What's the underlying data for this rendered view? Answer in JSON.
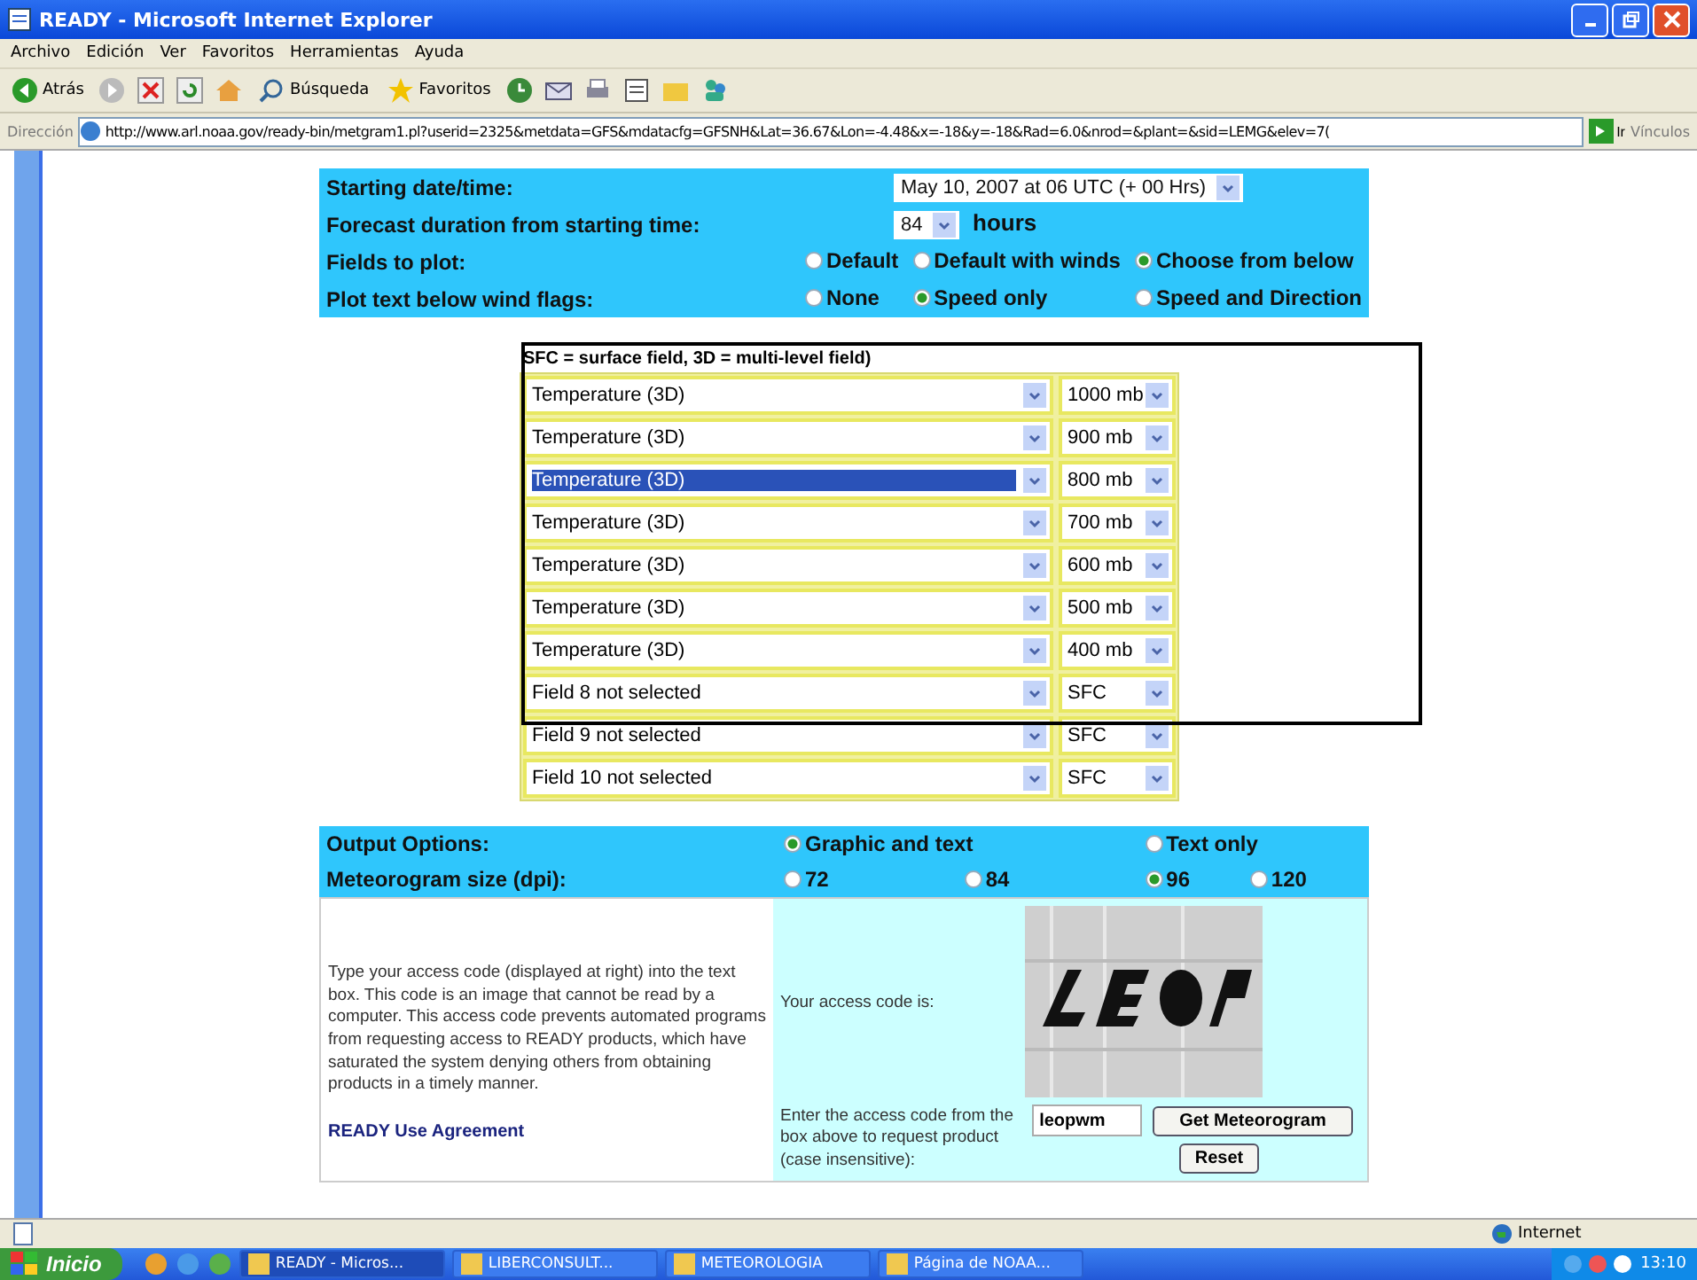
{
  "window": {
    "title": "READY - Microsoft Internet Explorer"
  },
  "menu": [
    "Archivo",
    "Edición",
    "Ver",
    "Favoritos",
    "Herramientas",
    "Ayuda"
  ],
  "toolbar": {
    "back_label": "Atrás",
    "search_label": "Búsqueda",
    "favorites_label": "Favoritos"
  },
  "address_bar": {
    "label": "Dirección",
    "url": "http://www.arl.noaa.gov/ready-bin/metgram1.pl?userid=2325&metdata=GFS&mdatacfg=GFSNH&Lat=36.67&Lon=-4.48&x=-18&y=-18&Rad=6.0&nrod=&plant=&sid=LEMG&elev=7(",
    "go_label": "Ir",
    "links_label": "Vínculos"
  },
  "settings": {
    "start": {
      "label": "Starting date/time:",
      "value": "May 10, 2007 at 06 UTC (+ 00 Hrs)"
    },
    "duration": {
      "label": "Forecast duration from starting time:",
      "value": "84",
      "unit": "hours"
    },
    "fields_to_plot": {
      "label": "Fields to plot:",
      "options": [
        {
          "label": "Default",
          "selected": false
        },
        {
          "label": "Default with winds",
          "selected": false
        },
        {
          "label": "Choose from below",
          "selected": true
        }
      ]
    },
    "plot_text": {
      "label": "Plot text below wind flags:",
      "options": [
        {
          "label": "None",
          "selected": false
        },
        {
          "label": "Speed only",
          "selected": true
        },
        {
          "label": "Speed and Direction",
          "selected": false
        }
      ]
    }
  },
  "fields": {
    "note": "SFC = surface field, 3D = multi-level field)",
    "rows": [
      {
        "field": "Temperature (3D)",
        "level": "1000 mb",
        "selected": false
      },
      {
        "field": "Temperature (3D)",
        "level": "900 mb",
        "selected": false
      },
      {
        "field": "Temperature (3D)",
        "level": "800 mb",
        "selected": true
      },
      {
        "field": "Temperature (3D)",
        "level": "700 mb",
        "selected": false
      },
      {
        "field": "Temperature (3D)",
        "level": "600 mb",
        "selected": false
      },
      {
        "field": "Temperature (3D)",
        "level": "500 mb",
        "selected": false
      },
      {
        "field": "Temperature (3D)",
        "level": "400 mb",
        "selected": false
      },
      {
        "field": "Field 8 not selected",
        "level": "SFC",
        "selected": false
      },
      {
        "field": "Field 9 not selected",
        "level": "SFC",
        "selected": false
      },
      {
        "field": "Field 10 not selected",
        "level": "SFC",
        "selected": false
      }
    ]
  },
  "output": {
    "output_options": {
      "label": "Output Options:",
      "options": [
        {
          "label": "Graphic and text",
          "selected": true
        },
        {
          "label": "Text only",
          "selected": false
        }
      ]
    },
    "size": {
      "label": "Meteorogram size (dpi):",
      "options": [
        {
          "label": "72",
          "selected": false
        },
        {
          "label": "84",
          "selected": false
        },
        {
          "label": "96",
          "selected": true
        },
        {
          "label": "120",
          "selected": false
        }
      ]
    }
  },
  "access": {
    "instructions": "Type your access code (displayed at right) into the text box. This code is an image that cannot be read by a computer. This access code prevents automated programs from requesting access to READY products, which have saturated the system denying others from obtaining products in a timely manner.",
    "agreement_link": "READY Use Agreement",
    "code_label": "Your access code is:",
    "enter_label": "Enter the access code from the box above to request product (case insensitive):",
    "code_value": "leopwm",
    "submit": "Get Meteorogram",
    "reset": "Reset"
  },
  "status_bar": {
    "zone": "Internet"
  },
  "taskbar": {
    "start": "Inicio",
    "tasks": [
      {
        "label": "READY - Micros...",
        "selected": true
      },
      {
        "label": "LIBERCONSULT...",
        "selected": false
      },
      {
        "label": "METEOROLOGIA",
        "selected": false
      },
      {
        "label": "Página de NOAA...",
        "selected": false
      }
    ],
    "clock": "13:10"
  }
}
